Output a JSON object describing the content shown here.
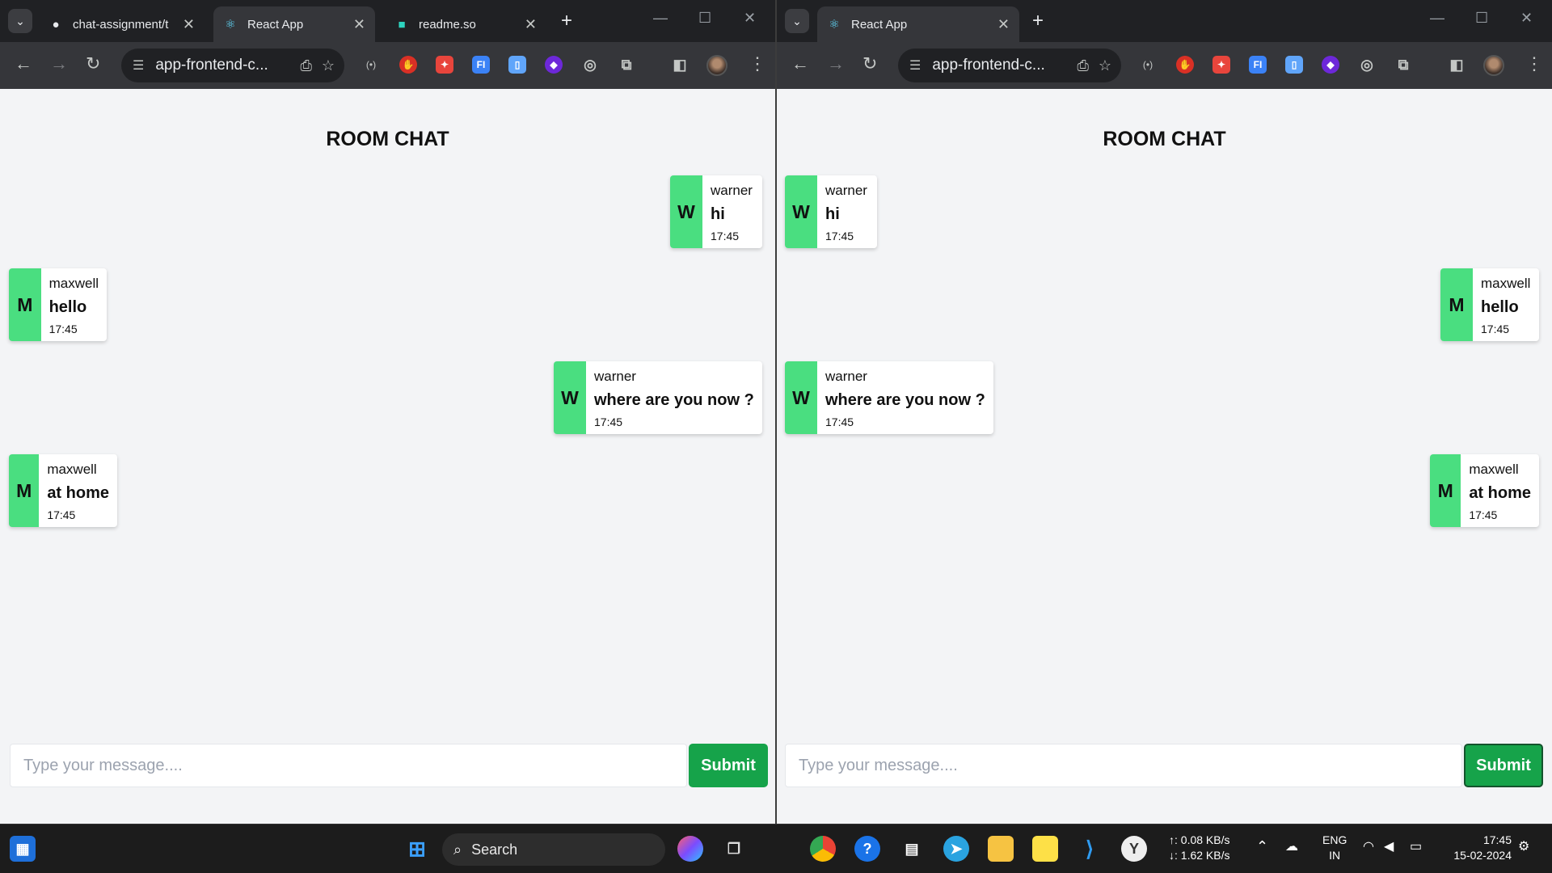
{
  "left_window": {
    "tabs": [
      {
        "title": "chat-assignment/t",
        "icon": "github-icon"
      },
      {
        "title": "React App",
        "icon": "react-icon"
      },
      {
        "title": "readme.so",
        "icon": "readme-icon"
      }
    ],
    "url": "app-frontend-c...",
    "room_title": "ROOM CHAT",
    "messages": [
      {
        "initial": "W",
        "user": "warner",
        "text": "hi",
        "time": "17:45",
        "side": "right"
      },
      {
        "initial": "M",
        "user": "maxwell",
        "text": "hello",
        "time": "17:45",
        "side": "left"
      },
      {
        "initial": "W",
        "user": "warner",
        "text": "where are you now ?",
        "time": "17:45",
        "side": "right"
      },
      {
        "initial": "M",
        "user": "maxwell",
        "text": "at home",
        "time": "17:45",
        "side": "left"
      }
    ],
    "input_placeholder": "Type your message....",
    "submit_label": "Submit"
  },
  "right_window": {
    "tabs": [
      {
        "title": "React App",
        "icon": "react-icon"
      }
    ],
    "url": "app-frontend-c...",
    "room_title": "ROOM CHAT",
    "messages": [
      {
        "initial": "W",
        "user": "warner",
        "text": "hi",
        "time": "17:45",
        "side": "left"
      },
      {
        "initial": "M",
        "user": "maxwell",
        "text": "hello",
        "time": "17:45",
        "side": "right"
      },
      {
        "initial": "W",
        "user": "warner",
        "text": "where are you now ?",
        "time": "17:45",
        "side": "left"
      },
      {
        "initial": "M",
        "user": "maxwell",
        "text": "at home",
        "time": "17:45",
        "side": "right"
      }
    ],
    "input_placeholder": "Type your message....",
    "submit_label": "Submit"
  },
  "colors": {
    "avatar_green": "#4ade80",
    "submit_green": "#16a34a",
    "page_bg": "#f3f4f6"
  },
  "taskbar": {
    "search_label": "Search",
    "net_up": "↑: 0.08 KB/s",
    "net_down": "↓: 1.62 KB/s",
    "lang_top": "ENG",
    "lang_bottom": "IN",
    "time": "17:45",
    "date": "15-02-2024"
  }
}
